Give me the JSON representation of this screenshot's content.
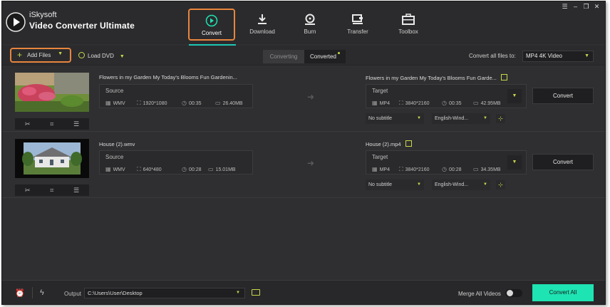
{
  "brand": {
    "line1": "iSkysoft",
    "line2": "Video Converter Ultimate"
  },
  "nav": [
    {
      "label": "Convert",
      "icon": "convert-icon",
      "active": true
    },
    {
      "label": "Download",
      "icon": "download-icon"
    },
    {
      "label": "Burn",
      "icon": "burn-icon"
    },
    {
      "label": "Transfer",
      "icon": "transfer-icon"
    },
    {
      "label": "Toolbox",
      "icon": "toolbox-icon"
    }
  ],
  "window_controls": [
    "menu-icon",
    "minimize-icon",
    "restore-icon",
    "close-icon"
  ],
  "toolbar": {
    "add_files": "Add Files",
    "load_dvd": "Load DVD",
    "tab_converting": "Converting",
    "tab_converted": "Converted",
    "convert_all_to_label": "Convert all files to:",
    "convert_all_to_value": "MP4 4K Video"
  },
  "files": [
    {
      "source_name": "Flowers in my Garden  My Today's Blooms  Fun Gardenin...",
      "source_label": "Source",
      "source_format": "WMV",
      "source_resolution": "1920*1080",
      "source_duration": "00:35",
      "source_size": "26.40MB",
      "target_name": "Flowers in my Garden  My Today's Blooms  Fun Garde...",
      "target_label": "Target",
      "target_format": "MP4",
      "target_resolution": "3840*2160",
      "target_duration": "00:35",
      "target_size": "42.95MB",
      "subtitle": "No subtitle",
      "audio": "English-Wind...",
      "convert_label": "Convert"
    },
    {
      "source_name": "House (2).wmv",
      "source_label": "Source",
      "source_format": "WMV",
      "source_resolution": "640*480",
      "source_duration": "00:28",
      "source_size": "15.01MB",
      "target_name": "House (2).mp4",
      "target_label": "Target",
      "target_format": "MP4",
      "target_resolution": "3840*2160",
      "target_duration": "00:28",
      "target_size": "34.35MB",
      "subtitle": "No subtitle",
      "audio": "English-Wind...",
      "convert_label": "Convert"
    }
  ],
  "footer": {
    "output_label": "Output",
    "output_path": "C:\\Users\\User\\Desktop",
    "merge_label": "Merge All Videos",
    "merge_on": false,
    "convert_all": "Convert All"
  },
  "colors": {
    "accent": "#1ee3b3",
    "highlight": "#e8853d",
    "lime": "#c9d84a",
    "bg": "#2f2f31"
  }
}
